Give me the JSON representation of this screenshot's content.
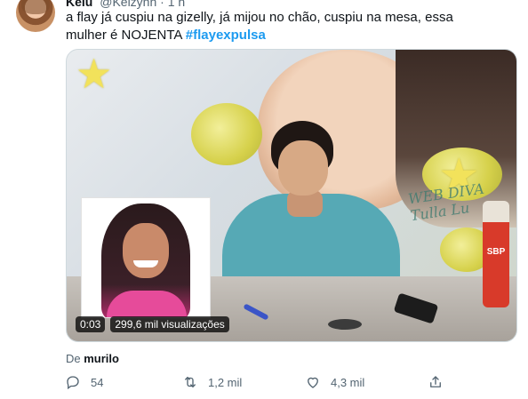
{
  "header": {
    "name": "Kelu",
    "handle": "@Kelzynh",
    "separator": "·",
    "time": "1 h"
  },
  "tweet": {
    "text": "a flay já cuspiu na gizelly, já mijou no chão, cuspiu na mesa, essa mulher é NOJENTA",
    "hashtag": "#flayexpulsa"
  },
  "media": {
    "elapsed": "0:03",
    "views": "299,6 mil visualizações",
    "background_text": "WEB DIVA Tulla Lu",
    "product_label": "SBP"
  },
  "from": {
    "prefix": "De",
    "user": "murilo"
  },
  "actions": {
    "replies": "54",
    "retweets": "1,2 mil",
    "likes": "4,3 mil"
  },
  "icons": {
    "reply": "reply-icon",
    "retweet": "retweet-icon",
    "like": "like-icon",
    "share": "share-icon"
  },
  "colors": {
    "hashtag": "#1d9bf0",
    "secondary_text": "#536471",
    "primary_text": "#0f1419"
  }
}
